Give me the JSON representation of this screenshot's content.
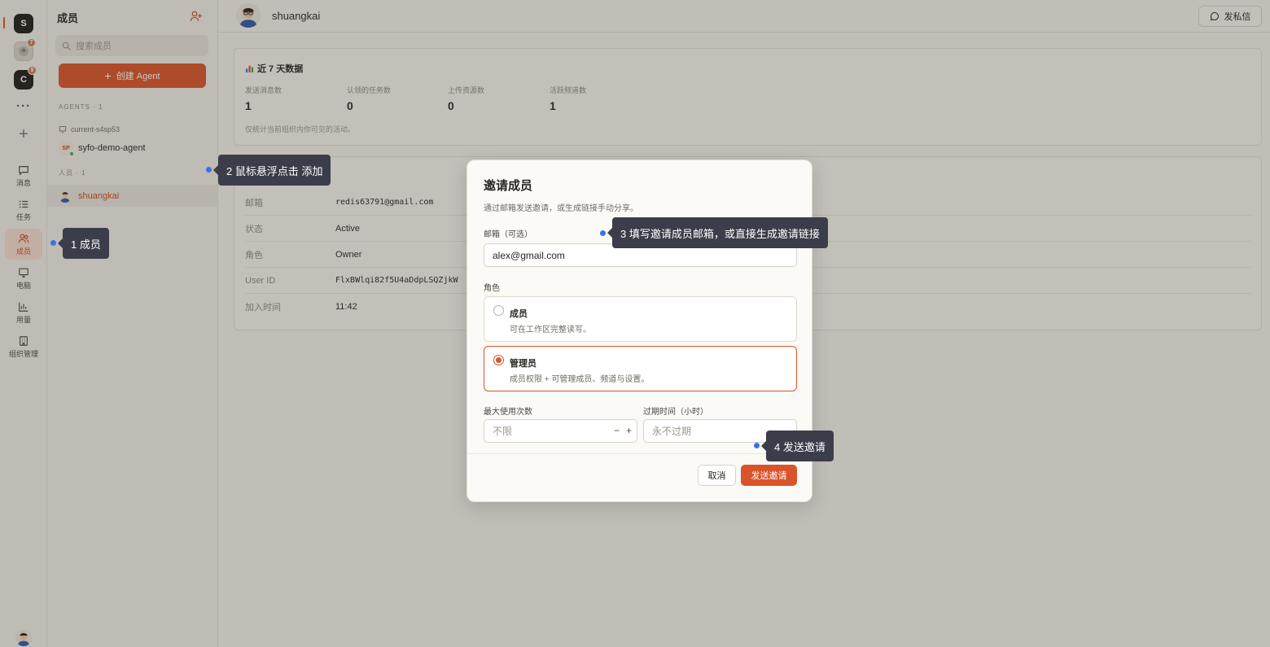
{
  "rail": {
    "workspaces": [
      {
        "letter": "S",
        "badge": ""
      },
      {
        "letter": "",
        "badge": "7"
      },
      {
        "letter": "C",
        "badge": "9"
      }
    ],
    "more_label": "···",
    "add_label": "+",
    "nav": [
      {
        "label": "消息",
        "icon": "message-icon"
      },
      {
        "label": "任务",
        "icon": "task-list-icon"
      },
      {
        "label": "成员",
        "icon": "members-icon"
      },
      {
        "label": "电脑",
        "icon": "computer-icon"
      },
      {
        "label": "用量",
        "icon": "usage-chart-icon"
      },
      {
        "label": "组织管理",
        "icon": "organization-icon"
      }
    ]
  },
  "sidebar": {
    "title": "成员",
    "search_placeholder": "搜索成员",
    "create_button": "创建 Agent",
    "agents_section": "AGENTS · 1",
    "machine": "current-s4sp53",
    "agent": {
      "initials": "SP",
      "name": "syfo-demo-agent"
    },
    "people_section": "人员 · 1",
    "member": {
      "name": "shuangkai"
    }
  },
  "main": {
    "user_name": "shuangkai",
    "dm_button": "发私信",
    "stats": {
      "title": "近 7 天数据",
      "items": [
        {
          "label": "发送消息数",
          "value": "1"
        },
        {
          "label": "认领的任务数",
          "value": "0"
        },
        {
          "label": "上传资源数",
          "value": "0"
        },
        {
          "label": "活跃频道数",
          "value": "1"
        }
      ],
      "note": "仅统计当前组织内你可见的活动。"
    },
    "info": [
      {
        "key": "邮箱",
        "value": "redis63791@gmail.com"
      },
      {
        "key": "状态",
        "value": "Active"
      },
      {
        "key": "角色",
        "value": "Owner"
      },
      {
        "key": "User ID",
        "value": "FlxBWlqi82f5U4aDdpLSQZjkW"
      },
      {
        "key": "加入时间",
        "value": "11:42"
      }
    ]
  },
  "modal": {
    "title": "邀请成员",
    "subtitle": "通过邮箱发送邀请，或生成链接手动分享。",
    "email_label": "邮箱（可选）",
    "email_value": "alex@gmail.com",
    "role_label": "角色",
    "roles": [
      {
        "title": "成员",
        "desc": "可在工作区完整读写。",
        "selected": false
      },
      {
        "title": "管理员",
        "desc": "成员权限 + 可管理成员、频道与设置。",
        "selected": true
      }
    ],
    "max_uses_label": "最大使用次数",
    "max_uses_placeholder": "不限",
    "expiry_label": "过期时间（小时）",
    "expiry_placeholder": "永不过期",
    "cancel": "取消",
    "send": "发送邀请"
  },
  "callouts": [
    "1 成员",
    "2 鼠标悬浮点击 添加",
    "3 填写邀请成员邮箱，或直接生成邀请链接",
    "4 发送邀请"
  ],
  "colors": {
    "accent": "#d9542a",
    "callout": "#3b3d4a",
    "dot": "#3a72e8"
  }
}
